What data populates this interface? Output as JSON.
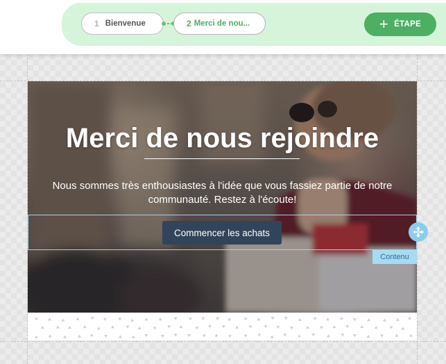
{
  "steps": [
    {
      "number": "1",
      "label": "Bienvenue"
    },
    {
      "number": "2",
      "label": "Merci de nou..."
    }
  ],
  "add_step": {
    "label": "ÉTAPE",
    "icon": "plus-icon"
  },
  "hero": {
    "title": "Merci de nous rejoindre",
    "text": "Nous sommes très enthousiastes à l'idée que vous fassiez partie de notre communauté. Restez à l'écoute!",
    "cta_label": "Commencer les achats"
  },
  "selection": {
    "tag_label": "Contenu",
    "handle_icon": "move-icon"
  },
  "colors": {
    "accent_green": "#4caf63",
    "panel_green": "#d6f4d9",
    "cta_dark": "#32445a",
    "selection_blue": "#8ccdee"
  }
}
